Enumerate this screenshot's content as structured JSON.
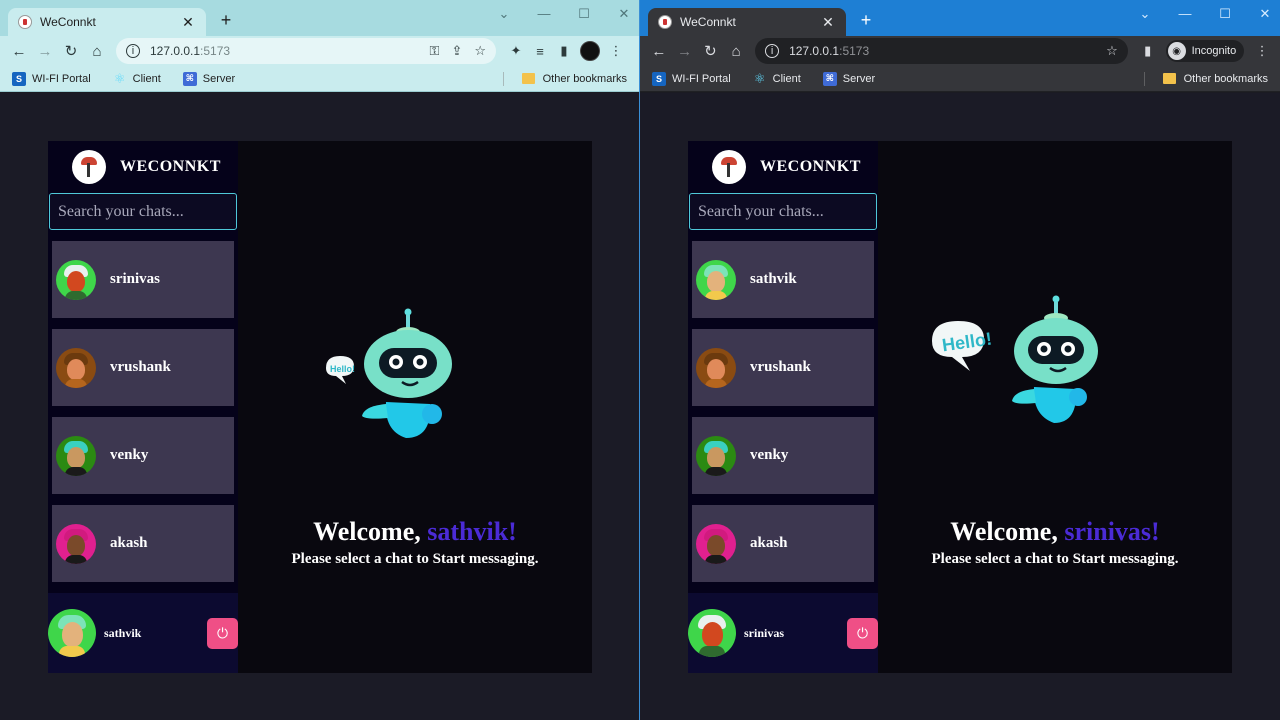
{
  "left": {
    "tab_title": "WeConnkt",
    "url_host": "127.0.0.1",
    "url_port": ":5173",
    "bookmarks": [
      "WI-FI Portal",
      "Client",
      "Server"
    ],
    "other_bookmarks": "Other bookmarks",
    "brand": "WECONNKT",
    "search_placeholder": "Search your chats...",
    "chats": [
      {
        "name": "srinivas"
      },
      {
        "name": "vrushank"
      },
      {
        "name": "venky"
      },
      {
        "name": "akash"
      }
    ],
    "current_user": "sathvik",
    "welcome_prefix": "Welcome, ",
    "welcome_name": "sathvik!",
    "welcome_sub": "Please select a chat to Start messaging.",
    "bubble_text": "Hello!"
  },
  "right": {
    "tab_title": "WeConnkt",
    "url_host": "127.0.0.1",
    "url_port": ":5173",
    "incognito_label": "Incognito",
    "bookmarks": [
      "WI-FI Portal",
      "Client",
      "Server"
    ],
    "other_bookmarks": "Other bookmarks",
    "brand": "WECONNKT",
    "search_placeholder": "Search your chats...",
    "chats": [
      {
        "name": "sathvik"
      },
      {
        "name": "vrushank"
      },
      {
        "name": "venky"
      },
      {
        "name": "akash"
      }
    ],
    "current_user": "srinivas",
    "welcome_prefix": "Welcome, ",
    "welcome_name": "srinivas!",
    "welcome_sub": "Please select a chat to Start messaging.",
    "bubble_text": "Hello!"
  },
  "colors": {
    "accent_name": "#4b2bd6",
    "logout": "#ef4f86",
    "chat_item": "#3d3750",
    "search_border": "#4fc8d8"
  },
  "avatars": {
    "srinivas": {
      "bg": "#3fd64a",
      "face": "#d2481f",
      "hair": "#e8f0ee",
      "body": "#2f6b2f"
    },
    "sathvik": {
      "bg": "#3fd64a",
      "face": "#e3b27c",
      "hair": "#7de3b8",
      "body": "#f2c94c"
    },
    "vrushank": {
      "bg": "#8a4b12",
      "face": "#e08a5a",
      "hair": "#6b3a0e",
      "body": "#b5651d"
    },
    "venky": {
      "bg": "#2b8a12",
      "face": "#c99860",
      "hair": "#3ad1c0",
      "body": "#1a1a1a"
    },
    "akash": {
      "bg": "#e0208f",
      "face": "#7a4a2a",
      "hair": "#d11a7f",
      "body": "#1a1a1a"
    }
  }
}
